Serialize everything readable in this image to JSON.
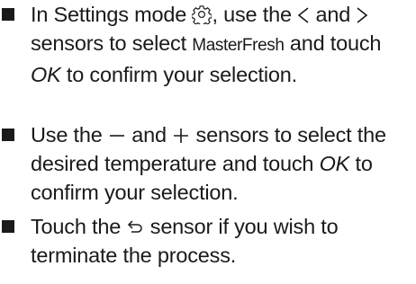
{
  "instructions": {
    "item1": {
      "part1": "In Settings mode ",
      "part2": ", use the ",
      "part3": " and ",
      "part4": " sensors to select ",
      "mode_label": "MasterFresh",
      "part5": " and touch ",
      "ok": "OK",
      "part6": " to confirm your selection.",
      "icons": [
        "settings-gear-icon",
        "left-arrow-icon",
        "right-arrow-icon"
      ]
    },
    "item2": {
      "part1": "Use the ",
      "part2": " and ",
      "part3": " sensors to select the desired temperature and touch ",
      "ok": "OK",
      "part4": " to confirm your selection.",
      "icons": [
        "minus-icon",
        "plus-icon"
      ]
    },
    "item3": {
      "part1": "Touch the ",
      "part2": " sensor if you wish to terminate the process.",
      "icons": [
        "back-arrow-icon"
      ]
    }
  }
}
